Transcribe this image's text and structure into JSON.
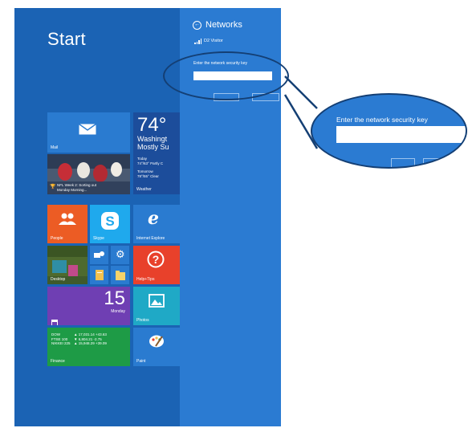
{
  "start_screen": {
    "title": "Start",
    "tiles": {
      "mail": "Mail",
      "weather": {
        "temperature": "74°",
        "city": "Washingt",
        "condition": "Mostly Su",
        "today_label": "Today",
        "today_forecast": "74°/63° Partly C",
        "tomorrow_label": "Tomorrow",
        "tomorrow_forecast": "78°/55° Clear",
        "label": "Weather"
      },
      "news": "NFL Week 2: Sorting out Monday Morning...",
      "people": "People",
      "skype": "Skype",
      "internet_explorer": "Internet Explore",
      "desktop": "Desktop",
      "help": "Help+Tips",
      "calendar": {
        "day": "15",
        "weekday": "Monday"
      },
      "photos": "Photos",
      "finance": {
        "label": "Finance",
        "rows": [
          {
            "name": "DOW",
            "value": "▲ 17,031.14 +43.63"
          },
          {
            "name": "FTSE 100",
            "value": "▼ 6,804.21 -2.75"
          },
          {
            "name": "NIKKEI 225",
            "value": "▲ 15,948.29 +39.09"
          }
        ]
      },
      "paint": "Paint"
    }
  },
  "networks_pane": {
    "title": "Networks",
    "network_name": "D2 Visitor",
    "key_label": "Enter the network security key",
    "key_value": "",
    "next_label": "",
    "cancel_label": ""
  },
  "zoom_callout": {
    "key_label": "Enter the network security key",
    "key_value": ""
  },
  "colors": {
    "screen_bg": "#1b63b4",
    "charms_bg": "#2b7bd2",
    "tile_blue": "#2a7bd0",
    "tile_orange": "#ec5c24",
    "tile_red": "#e8412b",
    "tile_purple": "#6f3fb3",
    "tile_green": "#1e9b46",
    "tile_dark_blue": "#1c4d9b",
    "callout_outline": "#143f74"
  },
  "icons": [
    "envelope-icon",
    "people-icon",
    "skype-icon",
    "internet-explorer-icon",
    "help-icon",
    "calendar-icon",
    "photos-icon",
    "paint-icon",
    "back-arrow-icon",
    "wifi-signal-icon",
    "trophy-icon"
  ]
}
